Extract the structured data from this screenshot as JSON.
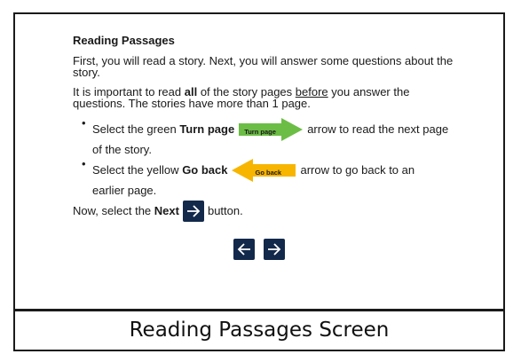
{
  "heading": "Reading Passages",
  "para1": "First, you will read a story. Next, you will answer some questions about the story.",
  "para2": {
    "part1": "It is important to read ",
    "bold": "all",
    "part2": " of the story pages ",
    "underline": "before",
    "part3": " you answer the questions. The stories have more than 1 page."
  },
  "bullet1": {
    "dot": "•",
    "prefix": "Select the green ",
    "bold": "Turn page",
    "arrow_label": "Turn page",
    "suffix": "arrow to read the next page",
    "continuation": "of the story.",
    "arrow_color": "#6cbd45"
  },
  "bullet2": {
    "dot": "•",
    "prefix": "Select the yellow ",
    "bold": "Go back",
    "arrow_label": "Go back",
    "suffix": "arrow to go back to an",
    "continuation": "earlier page.",
    "arrow_color": "#f7b500"
  },
  "instruction": {
    "prefix": "Now, select the ",
    "bold": "Next",
    "suffix": "button."
  },
  "nav": {
    "back_icon": "arrow-left-icon",
    "next_icon": "arrow-right-icon",
    "button_color": "#13294b"
  },
  "caption": "Reading Passages Screen"
}
